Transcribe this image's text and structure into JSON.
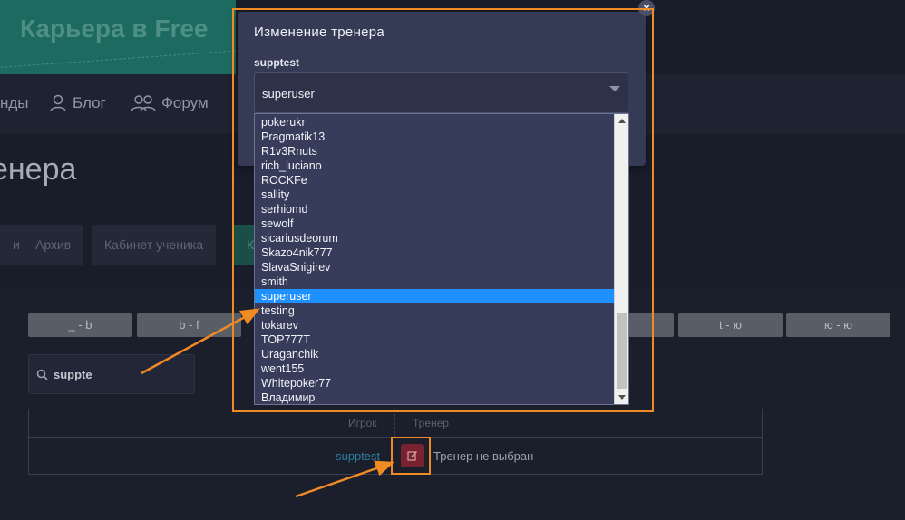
{
  "banner": {
    "title": "Карьера в Free"
  },
  "nav": {
    "items": [
      {
        "label": "нды",
        "icon": "none"
      },
      {
        "label": "Блог",
        "icon": "user-icon"
      },
      {
        "label": "Форум",
        "icon": "users-icon"
      }
    ]
  },
  "page": {
    "title": "енера"
  },
  "tabs": [
    "и",
    "Архив",
    "Кабинет ученика",
    "К"
  ],
  "alphabet": [
    "_ - b",
    "b - f",
    "t - ю",
    "ю - ю"
  ],
  "search": {
    "value": "suppte"
  },
  "table": {
    "headers": {
      "player": "Игрок",
      "trainer": "Тренер"
    },
    "rows": [
      {
        "player": "supptest",
        "trainer": "Тренер не выбран"
      }
    ]
  },
  "modal": {
    "title": "Изменение тренера",
    "field_label": "supptest",
    "selected": "superuser",
    "close": "×",
    "options": [
      "pokerukr",
      "Pragmatik13",
      "R1v3Rnuts",
      "rich_luciano",
      "ROCKFe",
      "sallity",
      "serhiomd",
      "sewolf",
      "sicariusdeorum",
      "Skazo4nik777",
      "SlavaSnigirev",
      "smith",
      "superuser",
      "testing",
      "tokarev",
      "TOP777T",
      "Uraganchik",
      "went155",
      "Whitepoker77",
      "Владимир"
    ]
  },
  "colors": {
    "accent": "#f08a24",
    "selected": "#1e90ff",
    "modal_bg": "#363b55",
    "edit_button": "#7a2330"
  }
}
